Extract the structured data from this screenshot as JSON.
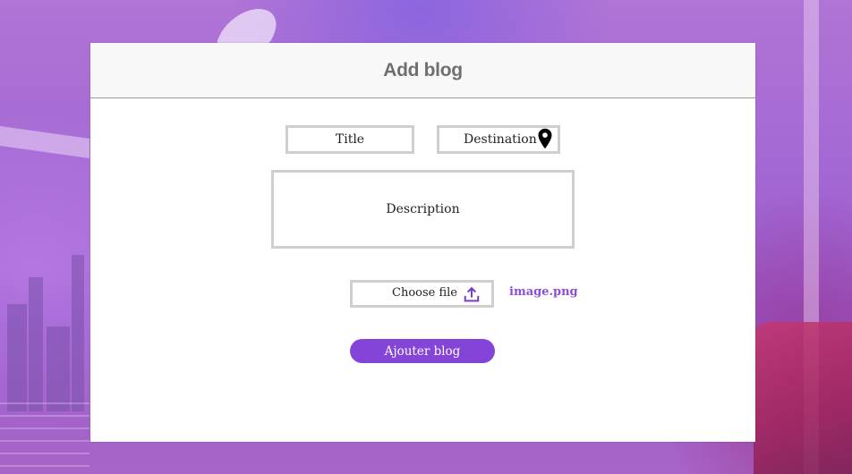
{
  "modal": {
    "title": "Add blog"
  },
  "form": {
    "title_placeholder": "Title",
    "destination_placeholder": "Destination",
    "destination_icon": "location-pin-icon",
    "description_placeholder": "Description",
    "file_picker_label": "Choose file",
    "file_picker_icon": "upload-icon",
    "selected_file_name": "image.png",
    "submit_label": "Ajouter blog"
  },
  "colors": {
    "accent": "#8444d8",
    "file_name": "#8a4fd6",
    "field_border": "#cfcfcf",
    "title_text": "#6f6f6f"
  }
}
